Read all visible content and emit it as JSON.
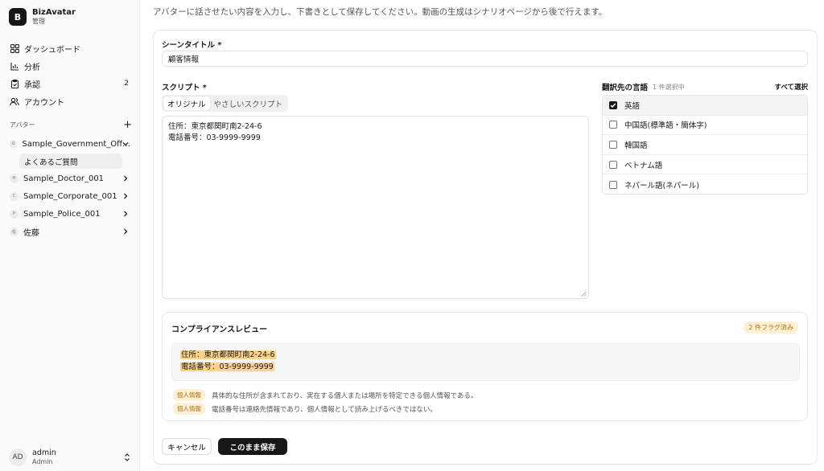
{
  "brand": {
    "logo_letter": "B",
    "name": "BizAvatar",
    "sub": "管理"
  },
  "nav": [
    {
      "label": "ダッシュボード",
      "icon": "dashboard-icon"
    },
    {
      "label": "分析",
      "icon": "bar-chart-icon"
    },
    {
      "label": "承認",
      "icon": "clipboard-check-icon",
      "count": "2"
    },
    {
      "label": "アカウント",
      "icon": "users-icon"
    }
  ],
  "avatars_section": {
    "title": "アバター",
    "items": [
      {
        "badge": "G",
        "label": "Sample_Government_Off…",
        "expanded": true
      },
      {
        "badge": "H",
        "label": "Sample_Doctor_001"
      },
      {
        "badge": "C",
        "label": "Sample_Corporate_001"
      },
      {
        "badge": "P",
        "label": "Sample_Police_001"
      },
      {
        "badge": "佐",
        "label": "佐藤"
      }
    ],
    "sub_item": "よくあるご質問"
  },
  "user": {
    "initials": "AD",
    "name": "admin",
    "role": "Admin"
  },
  "description": "アバターに話させたい内容を入力し、下書きとして保存してください。動画の生成はシナリオページから後で行えます。",
  "scene_title": {
    "label": "シーンタイトル *",
    "value": "顧客情報"
  },
  "script": {
    "label": "スクリプト *",
    "tabs": [
      "オリジナル",
      "やさしいスクリプト"
    ],
    "lines": [
      "住所：東京都関町南2-24-6",
      "電話番号：03-9999-9999"
    ]
  },
  "languages": {
    "title": "翻訳先の言語",
    "count": "1 件選択中",
    "select_all": "すべて選択",
    "items": [
      {
        "label": "英語",
        "checked": true
      },
      {
        "label": "中国語(標準語・簡体字)",
        "checked": false
      },
      {
        "label": "韓国語",
        "checked": false
      },
      {
        "label": "ベトナム語",
        "checked": false
      },
      {
        "label": "ネパール語(ネパール)",
        "checked": false
      }
    ]
  },
  "review": {
    "title": "コンプライアンスレビュー",
    "badge": "2 件フラグ済み",
    "highlights": [
      "住所：東京都関町南2-24-6",
      "電話番号：03-9999-9999"
    ],
    "flags": [
      {
        "tag": "個人情報",
        "text": "具体的な住所が含まれており、実在する個人または場所を特定できる個人情報である。"
      },
      {
        "tag": "個人情報",
        "text": "電話番号は連絡先情報であり、個人情報として読み上げるべきではない。"
      }
    ]
  },
  "buttons": {
    "cancel": "キャンセル",
    "save": "このまま保存"
  },
  "colors": {
    "accent": "#171717",
    "flag_bg": "#fdf0d5",
    "flag_text": "#b07010",
    "highlight": "#fbd48a"
  }
}
